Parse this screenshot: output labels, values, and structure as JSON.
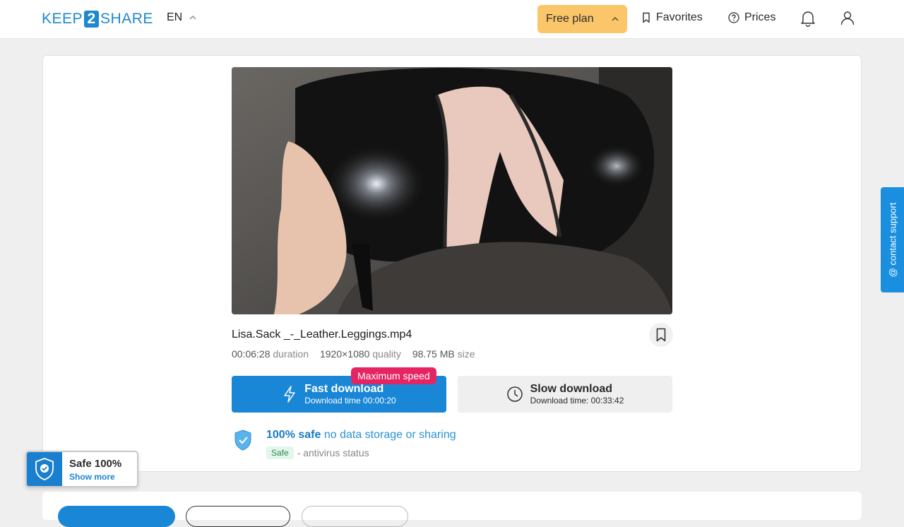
{
  "header": {
    "logo_left": "KEEP",
    "logo_num": "2",
    "logo_right": "SHARE",
    "lang": "EN",
    "plan_label": "Free plan",
    "favorites_label": "Favorites",
    "prices_label": "Prices"
  },
  "file": {
    "name": "Lisa.Sack _-_Leather.Leggings.mp4",
    "duration_value": "00:06:28",
    "duration_label": "duration",
    "quality_value": "1920×1080",
    "quality_label": "quality",
    "size_value": "98.75 MB",
    "size_label": "size"
  },
  "download": {
    "fast_label": "Fast download",
    "fast_time": "Download time 00:00:20",
    "speed_badge": "Maximum speed",
    "slow_label": "Slow download",
    "slow_time": "Download time: 00:33:42"
  },
  "safety": {
    "strong": "100% safe",
    "light": "no data storage or sharing",
    "av_badge": "Safe",
    "av_text": "- antivirus status"
  },
  "widget": {
    "title": "Safe 100%",
    "link": "Show more"
  },
  "support": {
    "label": "@ contact support"
  },
  "colors": {
    "brand": "#1e88cf",
    "plan_bg": "#fbc66a",
    "fast_bg": "#1a86d6",
    "badge_bg": "#e52463"
  }
}
